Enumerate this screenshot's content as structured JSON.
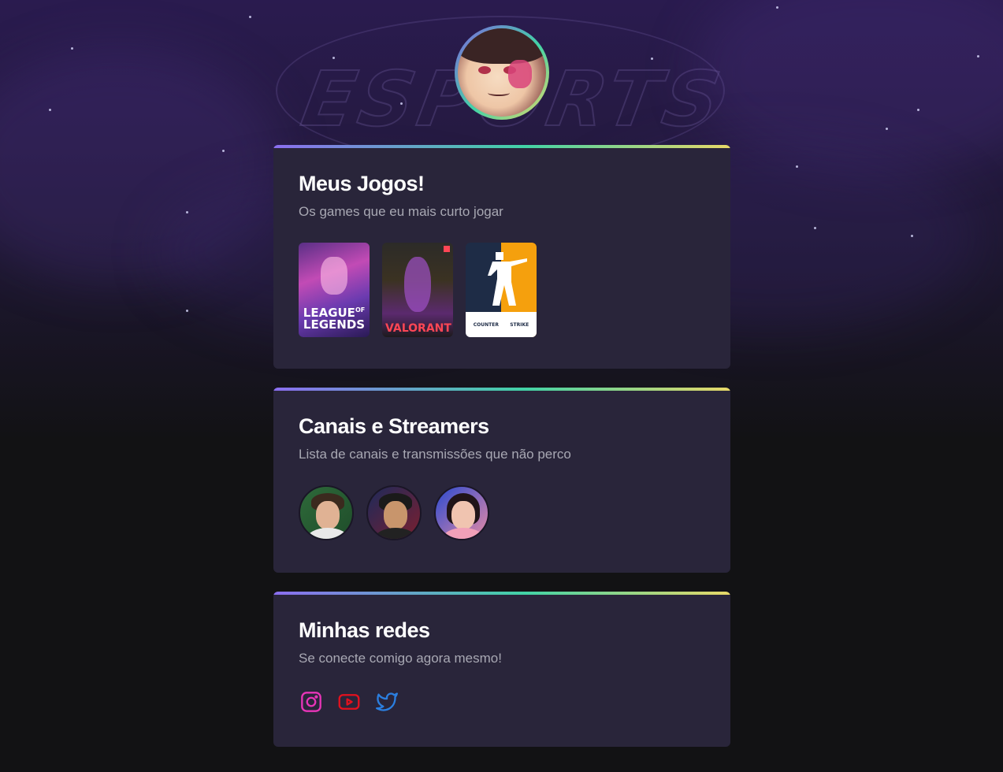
{
  "sections": [
    {
      "title": "Meus Jogos!",
      "subtitle": "Os games que eu mais curto jogar",
      "games": [
        {
          "name": "League of Legends",
          "label_line1": "LEAGUE",
          "label_sup": "OF",
          "label_line2": "LEGENDS"
        },
        {
          "name": "Valorant",
          "label": "VALORANT"
        },
        {
          "name": "Counter Strike",
          "label_left": "COUNTER",
          "label_right": "STRIKE"
        }
      ]
    },
    {
      "title": "Canais e Streamers",
      "subtitle": "Lista de canais e transmissões que não perco",
      "streamers": [
        {
          "name": "streamer-1"
        },
        {
          "name": "streamer-2"
        },
        {
          "name": "streamer-3"
        }
      ]
    },
    {
      "title": "Minhas redes",
      "subtitle": "Se conecte comigo agora mesmo!",
      "socials": [
        {
          "name": "instagram",
          "icon": "instagram-icon",
          "color": "#e835b8"
        },
        {
          "name": "youtube",
          "icon": "youtube-icon",
          "color": "#e3111e"
        },
        {
          "name": "twitter",
          "icon": "twitter-icon",
          "color": "#2b7fe0"
        }
      ]
    }
  ],
  "colors": {
    "background": "#121214",
    "card": "#29253a",
    "subtitle": "#a8a8b3",
    "gradient": [
      "#8b6ef0",
      "#42d3a6",
      "#e8d868"
    ]
  }
}
